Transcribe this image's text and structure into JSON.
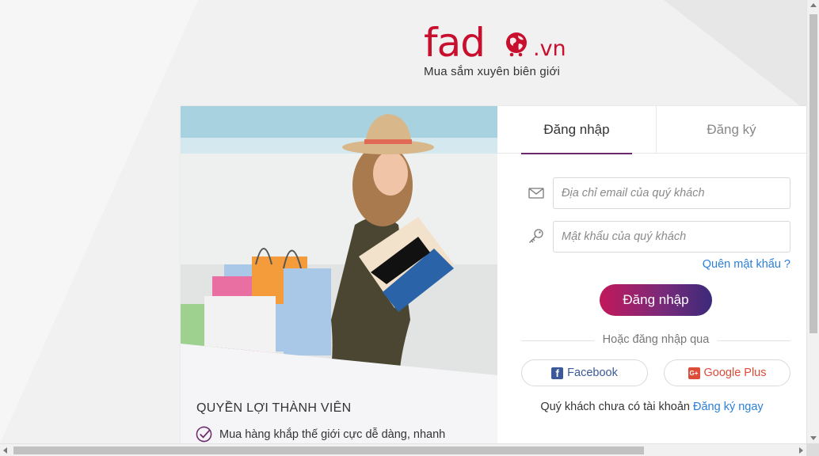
{
  "logo": {
    "word": "fad",
    "domain": ".vn",
    "tagline": "Mua sắm xuyên biên giới",
    "brand_color": "#c8102e"
  },
  "tabs": [
    {
      "label": "Đăng nhập",
      "active": true
    },
    {
      "label": "Đăng ký",
      "active": false
    }
  ],
  "form": {
    "email_placeholder": "Địa chỉ email của quý khách",
    "email_value": "",
    "email_icon": "envelope-icon",
    "password_placeholder": "Mật khẩu của quý khách",
    "password_value": "",
    "password_icon": "key-icon",
    "forgot_label": "Quên mật khẩu ?",
    "submit_label": "Đăng nhập"
  },
  "social": {
    "divider_text": "Hoặc đăng nhập qua",
    "facebook_label": "Facebook",
    "google_label": "Google Plus",
    "facebook_icon_glyph": "f",
    "google_icon_glyph": "G+"
  },
  "signup": {
    "prompt": "Quý khách chưa có tài khoản",
    "link": "Đăng ký ngay"
  },
  "benefits": {
    "title": "QUYỀN LỢI THÀNH VIÊN",
    "items": [
      "Mua hàng khắp thế giới cực dễ dàng, nhanh"
    ]
  },
  "colors": {
    "accent_link": "#2c7fd9",
    "button_gradient_start": "#c2185b",
    "button_gradient_end": "#3c2a7a",
    "facebook": "#3b5998",
    "google": "#dd4b39"
  }
}
